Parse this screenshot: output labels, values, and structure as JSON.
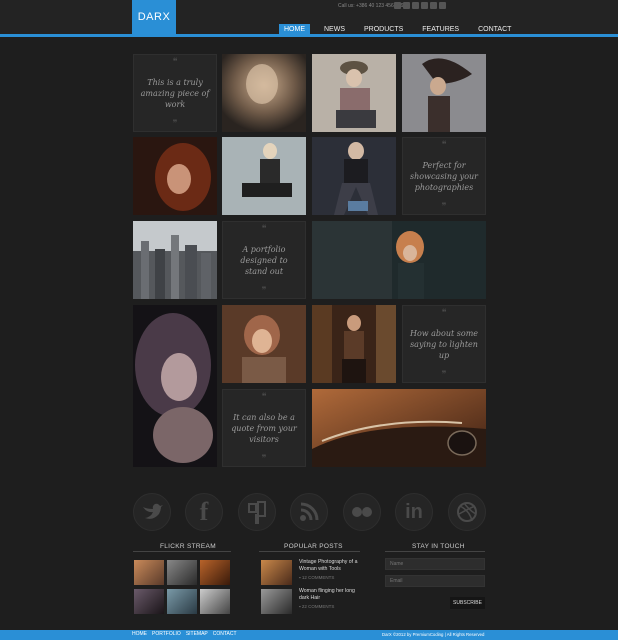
{
  "header": {
    "logo": "DARX",
    "callus": "Call us: +386 40 123 456 789",
    "nav": [
      "HOME",
      "NEWS",
      "PRODUCTS",
      "FEATURES",
      "CONTACT"
    ],
    "active_nav": "HOME"
  },
  "quotes": {
    "q1": "This is a truly amazing piece of work",
    "q2": "Perfect for showcasing your photographies",
    "q3": "A portfolio designed to stand out",
    "q4": "How about some saying to lighten up",
    "q5": "It can also be a quote from your visitors"
  },
  "widgets": {
    "flickr_title": "FLICKR STREAM",
    "posts_title": "POPULAR POSTS",
    "touch_title": "STAY IN TOUCH",
    "posts": [
      {
        "title": "Vintage Photography of a Woman with Tools",
        "comments": "12 COMMENTS"
      },
      {
        "title": "Woman flinging her long dark Hair",
        "comments": "22 COMMENTS"
      }
    ],
    "name_placeholder": "Name",
    "email_placeholder": "Email",
    "subscribe_label": "SUBSCRIBE"
  },
  "footer": {
    "nav": [
      "HOME",
      "PORTFOLIO",
      "SITEMAP",
      "CONTACT"
    ],
    "copyright": "DarX ©2012 by PremiumCoding | All Rights Reserved"
  },
  "colors": {
    "accent": "#2a8fd6",
    "background": "#1e1e1e",
    "tile": "#262626"
  },
  "icons": [
    "twitter-icon",
    "facebook-icon",
    "forrst-icon",
    "rss-icon",
    "flickr-icon",
    "linkedin-icon",
    "dribbble-icon"
  ]
}
